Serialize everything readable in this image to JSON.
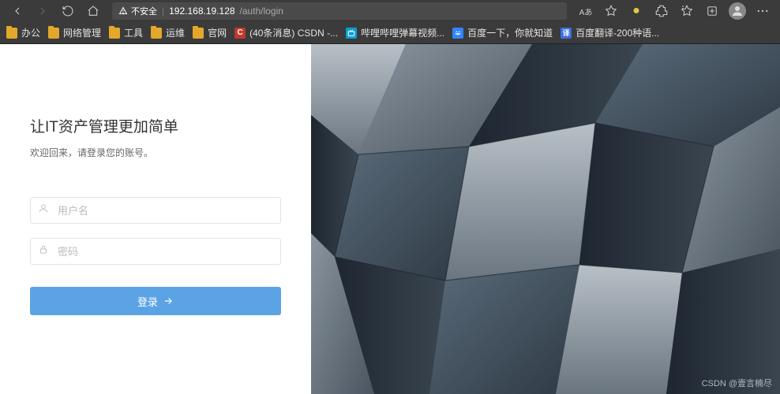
{
  "browser": {
    "security_label": "不安全",
    "url_host": "192.168.19.128",
    "url_path": "/auth/login",
    "read_aloud": "Aあ"
  },
  "bookmarks": [
    {
      "type": "folder",
      "label": "办公"
    },
    {
      "type": "folder",
      "label": "网络管理"
    },
    {
      "type": "folder",
      "label": "工具"
    },
    {
      "type": "folder",
      "label": "运维"
    },
    {
      "type": "folder",
      "label": "官网"
    },
    {
      "type": "site",
      "icon": "C",
      "label": "(40条消息) CSDN -..."
    },
    {
      "type": "site",
      "icon": "b",
      "label": "哔哩哔哩弹幕视频..."
    },
    {
      "type": "site",
      "icon": "bd",
      "label": "百度一下，你就知道"
    },
    {
      "type": "site",
      "icon": "y",
      "label": "百度翻译-200种语..."
    }
  ],
  "login": {
    "title": "让IT资产管理更加简单",
    "subtitle": "欢迎回来，请登录您的账号。",
    "username_placeholder": "用户名",
    "password_placeholder": "密码",
    "submit_label": "登录"
  },
  "watermark": "CSDN @壹言楠尽"
}
